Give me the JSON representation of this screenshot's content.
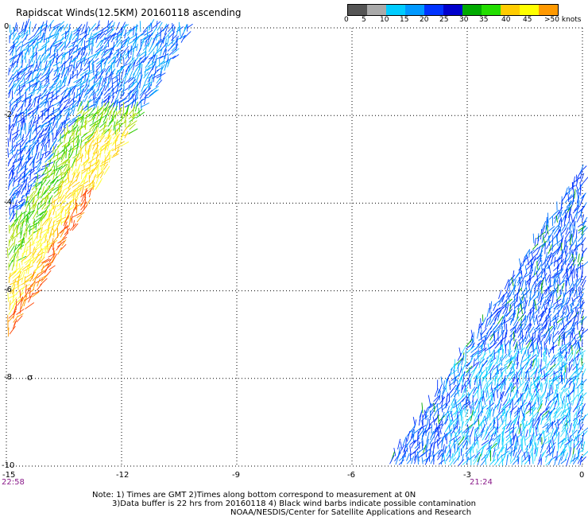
{
  "title": "Rapidscat Winds(12.5KM) 20160118 ascending",
  "legend": {
    "colors": [
      "#555555",
      "#aaaaaa",
      "#00ccff",
      "#0099ff",
      "#0033ff",
      "#0000cc",
      "#00aa00",
      "#22dd00",
      "#ffcc00",
      "#ffff00",
      "#ff9900",
      "#ff3300",
      "#cc0000",
      "#996633",
      "#663300",
      "#ff00ff",
      "#cc00cc",
      "#9900cc",
      "#660099",
      "#330066"
    ],
    "labels": [
      "0",
      "5",
      "10",
      "15",
      "20",
      "25",
      "30",
      "35",
      "40",
      "45",
      ">50 knots"
    ]
  },
  "axes": {
    "x_ticks": [
      "-15",
      "-12",
      "-9",
      "-6",
      "-3",
      "0"
    ],
    "y_ticks": [
      "0",
      "-2",
      "-4",
      "-6",
      "-8",
      "-10"
    ]
  },
  "times": {
    "left": "22:58",
    "right": "21:24"
  },
  "notes": {
    "line1": "Note: 1) Times are GMT 2)Times along bottom correspond to measurement at 0N",
    "line2": "3)Data buffer is 22 hrs from 20160118 4) Black wind barbs indicate possible contamination",
    "line3": "NOAA/NESDIS/Center for Satellite Applications and Research"
  },
  "swaths": [
    {
      "name": "west-swath",
      "polygon": [
        [
          -15,
          0
        ],
        [
          -10.2,
          0
        ],
        [
          -15,
          -7.2
        ]
      ]
    },
    {
      "name": "east-swath",
      "polygon": [
        [
          0,
          -3.2
        ],
        [
          0,
          -10
        ],
        [
          -5.1,
          -10
        ],
        [
          -2.3,
          -6.3
        ]
      ]
    }
  ],
  "marker_symbol": "σ"
}
